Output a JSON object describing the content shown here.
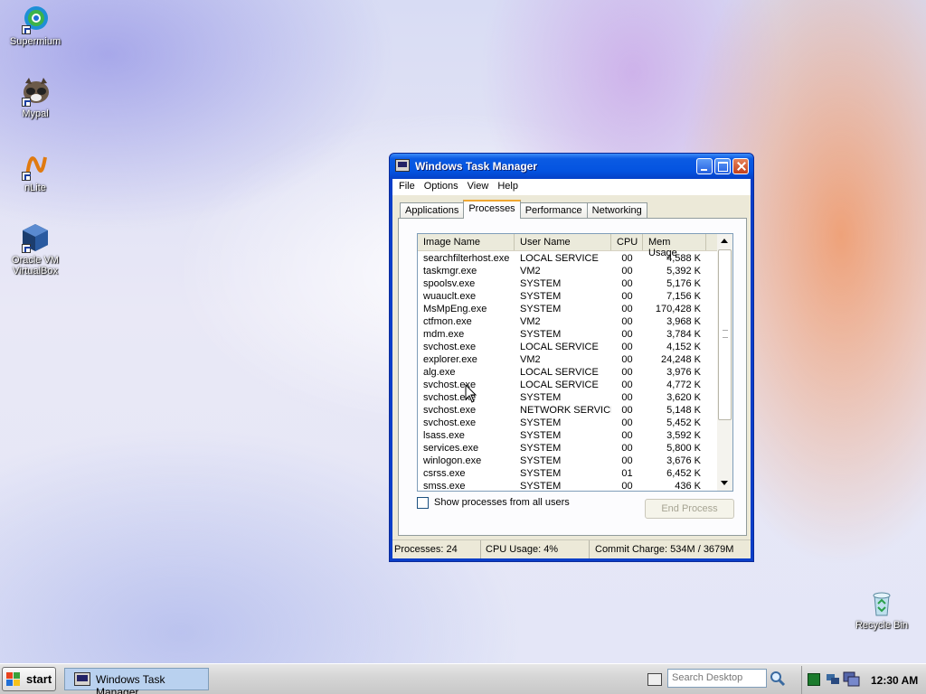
{
  "desktop": {
    "icons": [
      {
        "label": "Supermium"
      },
      {
        "label": "Mypal"
      },
      {
        "label": "nLite"
      },
      {
        "label": "Oracle VM VirtualBox"
      },
      {
        "label": "Recycle Bin"
      }
    ]
  },
  "window": {
    "title": "Windows Task Manager",
    "menu": [
      "File",
      "Options",
      "View",
      "Help"
    ],
    "tabs": [
      "Applications",
      "Processes",
      "Performance",
      "Networking"
    ],
    "active_tab": "Processes",
    "columns": [
      "Image Name",
      "User Name",
      "CPU",
      "Mem Usage"
    ],
    "processes": [
      {
        "name": "searchfilterhost.exe",
        "user": "LOCAL SERVICE",
        "cpu": "00",
        "mem": "4,588 K"
      },
      {
        "name": "taskmgr.exe",
        "user": "VM2",
        "cpu": "00",
        "mem": "5,392 K"
      },
      {
        "name": "spoolsv.exe",
        "user": "SYSTEM",
        "cpu": "00",
        "mem": "5,176 K"
      },
      {
        "name": "wuauclt.exe",
        "user": "SYSTEM",
        "cpu": "00",
        "mem": "7,156 K"
      },
      {
        "name": "MsMpEng.exe",
        "user": "SYSTEM",
        "cpu": "00",
        "mem": "170,428 K"
      },
      {
        "name": "ctfmon.exe",
        "user": "VM2",
        "cpu": "00",
        "mem": "3,968 K"
      },
      {
        "name": "mdm.exe",
        "user": "SYSTEM",
        "cpu": "00",
        "mem": "3,784 K"
      },
      {
        "name": "svchost.exe",
        "user": "LOCAL SERVICE",
        "cpu": "00",
        "mem": "4,152 K"
      },
      {
        "name": "explorer.exe",
        "user": "VM2",
        "cpu": "00",
        "mem": "24,248 K"
      },
      {
        "name": "alg.exe",
        "user": "LOCAL SERVICE",
        "cpu": "00",
        "mem": "3,976 K"
      },
      {
        "name": "svchost.exe",
        "user": "LOCAL SERVICE",
        "cpu": "00",
        "mem": "4,772 K"
      },
      {
        "name": "svchost.exe",
        "user": "SYSTEM",
        "cpu": "00",
        "mem": "3,620 K"
      },
      {
        "name": "svchost.exe",
        "user": "NETWORK SERVICE",
        "cpu": "00",
        "mem": "5,148 K"
      },
      {
        "name": "svchost.exe",
        "user": "SYSTEM",
        "cpu": "00",
        "mem": "5,452 K"
      },
      {
        "name": "lsass.exe",
        "user": "SYSTEM",
        "cpu": "00",
        "mem": "3,592 K"
      },
      {
        "name": "services.exe",
        "user": "SYSTEM",
        "cpu": "00",
        "mem": "5,800 K"
      },
      {
        "name": "winlogon.exe",
        "user": "SYSTEM",
        "cpu": "00",
        "mem": "3,676 K"
      },
      {
        "name": "csrss.exe",
        "user": "SYSTEM",
        "cpu": "01",
        "mem": "6,452 K"
      },
      {
        "name": "smss.exe",
        "user": "SYSTEM",
        "cpu": "00",
        "mem": "436 K"
      }
    ],
    "show_all_label": "Show processes from all users",
    "end_process_label": "End Process",
    "status": {
      "processes": "Processes: 24",
      "cpu": "CPU Usage: 4%",
      "commit": "Commit Charge: 534M / 3679M"
    }
  },
  "taskbar": {
    "start_label": "start",
    "task_button_label": "Windows Task Manager",
    "search_placeholder": "Search Desktop",
    "clock": "12:30 AM"
  },
  "icons": {
    "app": "task-manager-icon",
    "keyboard": "keyboard-icon",
    "search": "search-go-icon",
    "tray": [
      "antivirus-icon",
      "network-icon",
      "monitor-icon"
    ]
  }
}
